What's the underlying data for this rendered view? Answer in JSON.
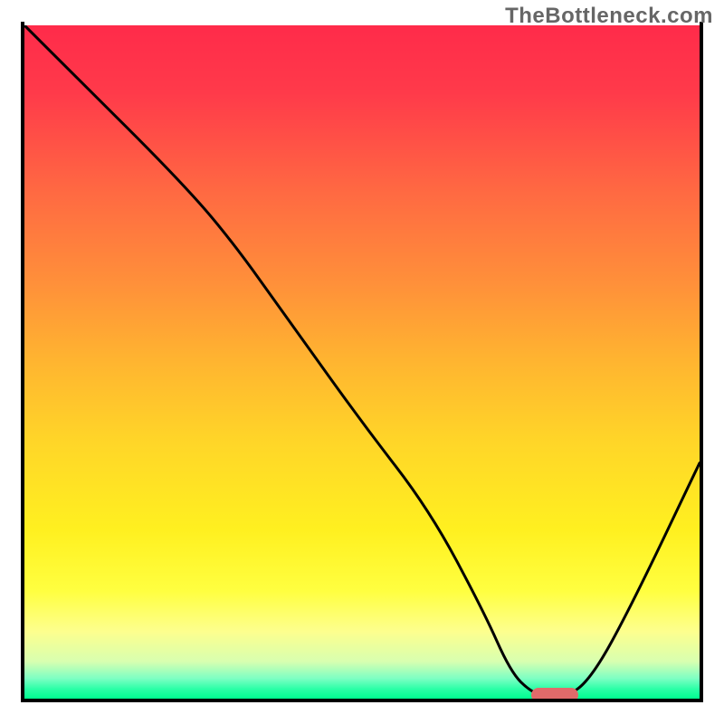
{
  "watermark": "TheBottleneck.com",
  "chart_data": {
    "type": "line",
    "title": "",
    "xlabel": "",
    "ylabel": "",
    "xlim": [
      0,
      100
    ],
    "ylim": [
      0,
      100
    ],
    "series": [
      {
        "name": "bottleneck-curve",
        "x": [
          0,
          8,
          22,
          30,
          40,
          50,
          60,
          68,
          72,
          75,
          78,
          80,
          84,
          90,
          100
        ],
        "values": [
          100,
          92,
          78,
          69,
          55,
          41,
          28,
          13,
          4,
          1,
          0,
          0,
          3,
          14,
          35
        ]
      }
    ],
    "marker": {
      "x_start": 75,
      "x_end": 82,
      "y": 0.6
    },
    "gradient_stops": [
      {
        "pct": 0,
        "color": "#ff2b4a"
      },
      {
        "pct": 25,
        "color": "#ff6a42"
      },
      {
        "pct": 50,
        "color": "#ffb530"
      },
      {
        "pct": 75,
        "color": "#fff020"
      },
      {
        "pct": 95,
        "color": "#d8ffb0"
      },
      {
        "pct": 100,
        "color": "#00ff90"
      }
    ]
  }
}
